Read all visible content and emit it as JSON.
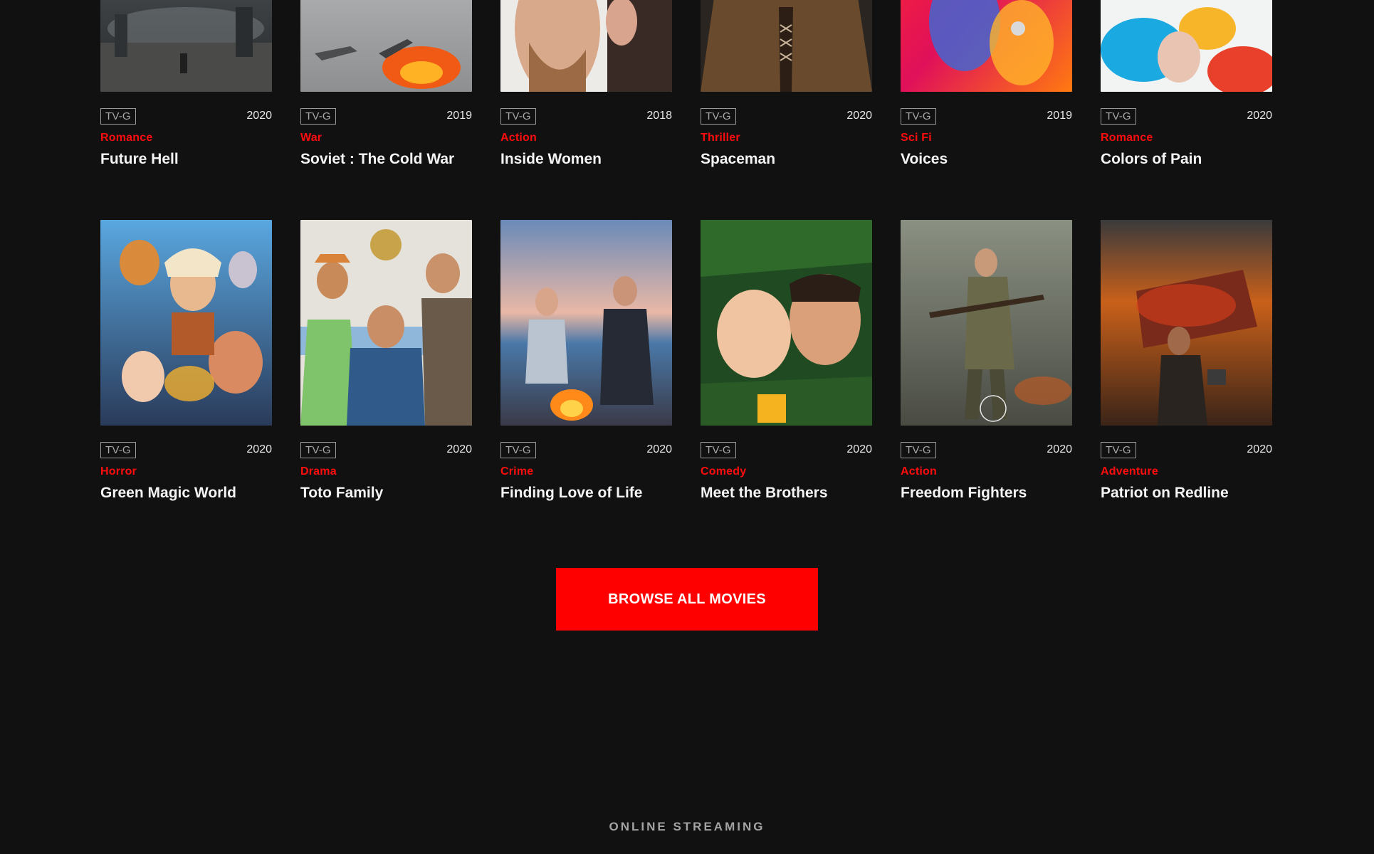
{
  "rows": [
    [
      {
        "rating": "TV-G",
        "year": "2020",
        "genre": "Romance",
        "title": "Future Hell"
      },
      {
        "rating": "TV-G",
        "year": "2019",
        "genre": "War",
        "title": "Soviet : The Cold War"
      },
      {
        "rating": "TV-G",
        "year": "2018",
        "genre": "Action",
        "title": "Inside Women"
      },
      {
        "rating": "TV-G",
        "year": "2020",
        "genre": "Thriller",
        "title": "Spaceman"
      },
      {
        "rating": "TV-G",
        "year": "2019",
        "genre": "Sci Fi",
        "title": "Voices"
      },
      {
        "rating": "TV-G",
        "year": "2020",
        "genre": "Romance",
        "title": "Colors of Pain"
      }
    ],
    [
      {
        "rating": "TV-G",
        "year": "2020",
        "genre": "Horror",
        "title": "Green Magic World"
      },
      {
        "rating": "TV-G",
        "year": "2020",
        "genre": "Drama",
        "title": "Toto Family"
      },
      {
        "rating": "TV-G",
        "year": "2020",
        "genre": "Crime",
        "title": "Finding Love of Life"
      },
      {
        "rating": "TV-G",
        "year": "2020",
        "genre": "Comedy",
        "title": "Meet the Brothers"
      },
      {
        "rating": "TV-G",
        "year": "2020",
        "genre": "Action",
        "title": "Freedom Fighters"
      },
      {
        "rating": "TV-G",
        "year": "2020",
        "genre": "Adventure",
        "title": "Patriot on Redline"
      }
    ]
  ],
  "browse_button": {
    "label": "BROWSE ALL MOVIES"
  },
  "footer": {
    "label": "ONLINE STREAMING"
  },
  "colors": {
    "background": "#111112",
    "accent": "#ff0000",
    "genre": "#ff0d0d"
  }
}
